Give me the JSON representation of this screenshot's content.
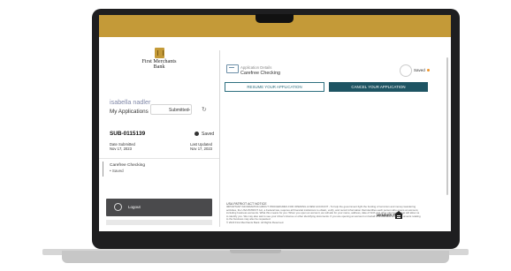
{
  "bank": {
    "name_line1": "First Merchants",
    "name_line2": "Bank"
  },
  "sidebar": {
    "user_name": "isabella nadler",
    "heading": "My Applications",
    "filter_value": "Submitted",
    "submission": {
      "id": "SUB-0115139",
      "status": "Saved",
      "date_submitted_label": "Date Submitted",
      "date_submitted_value": "Nov 17, 2023",
      "last_updated_label": "Last Updated",
      "last_updated_value": "Nov 17, 2023"
    },
    "application_item": {
      "name": "Carefree Checking",
      "state": "• Saved"
    },
    "logout_label": "Logout"
  },
  "main": {
    "details_label": "Application Details",
    "details_value": "Carefree Checking",
    "saved_label": "Saved",
    "resume_button": "RESUME YOUR APPLICATION",
    "cancel_button": "CANCEL YOUR APPLICATION"
  },
  "footer": {
    "heading": "USA PATRIOT ACT NOTICE",
    "text": "IMPORTANT INFORMATION ABOUT PROCEDURES FOR OPENING A NEW ACCOUNT - To help the government fight the funding of terrorism and money laundering activities, the USA PATRIOT Act, a Federal law, requires all financial institutions to obtain, verify, and record information that identifies each person who opens an account, including business accounts. What this means for you: When you open an account, we will ask for your name, address, date of birth and other information that will allow us to identify you. We may also ask to see your driver's license or other identifying documents. If you are opening an account on behalf of a business entity, documents relating to the business may also be requested.",
    "copyright": "© 2023 First Merchants Bank. All Rights Reserved.",
    "fdic_label": "MEMBER FDIC"
  },
  "colors": {
    "gold": "#c49a38",
    "teal_dark": "#1e5463",
    "teal_outline": "#2d6f7f",
    "logout_bg": "#4a4a4c",
    "saved_dot": "#f0942a"
  },
  "icons": {
    "logo": "gold-box-icon",
    "refresh": "refresh-icon",
    "saved": "check-circle-icon",
    "application": "application-card-icon",
    "logout": "logout-icon",
    "equal_housing": "house-icon"
  }
}
